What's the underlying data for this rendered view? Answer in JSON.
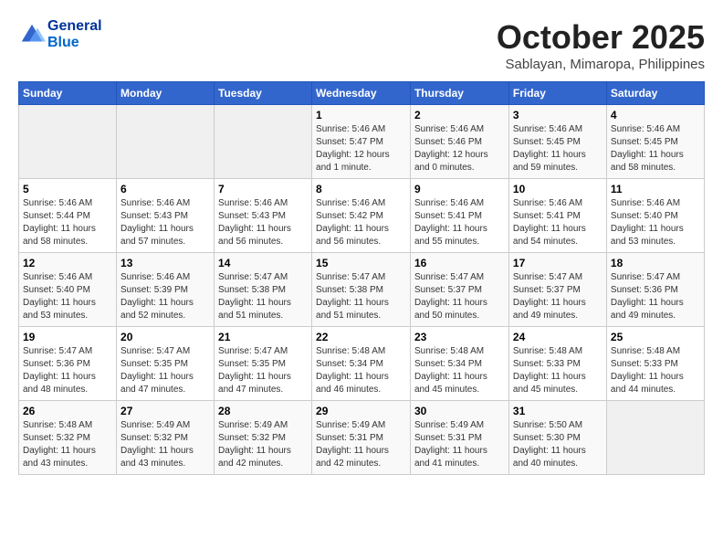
{
  "header": {
    "logo_line1": "General",
    "logo_line2": "Blue",
    "month": "October 2025",
    "location": "Sablayan, Mimaropa, Philippines"
  },
  "weekdays": [
    "Sunday",
    "Monday",
    "Tuesday",
    "Wednesday",
    "Thursday",
    "Friday",
    "Saturday"
  ],
  "weeks": [
    [
      {
        "day": "",
        "info": ""
      },
      {
        "day": "",
        "info": ""
      },
      {
        "day": "",
        "info": ""
      },
      {
        "day": "1",
        "info": "Sunrise: 5:46 AM\nSunset: 5:47 PM\nDaylight: 12 hours\nand 1 minute."
      },
      {
        "day": "2",
        "info": "Sunrise: 5:46 AM\nSunset: 5:46 PM\nDaylight: 12 hours\nand 0 minutes."
      },
      {
        "day": "3",
        "info": "Sunrise: 5:46 AM\nSunset: 5:45 PM\nDaylight: 11 hours\nand 59 minutes."
      },
      {
        "day": "4",
        "info": "Sunrise: 5:46 AM\nSunset: 5:45 PM\nDaylight: 11 hours\nand 58 minutes."
      }
    ],
    [
      {
        "day": "5",
        "info": "Sunrise: 5:46 AM\nSunset: 5:44 PM\nDaylight: 11 hours\nand 58 minutes."
      },
      {
        "day": "6",
        "info": "Sunrise: 5:46 AM\nSunset: 5:43 PM\nDaylight: 11 hours\nand 57 minutes."
      },
      {
        "day": "7",
        "info": "Sunrise: 5:46 AM\nSunset: 5:43 PM\nDaylight: 11 hours\nand 56 minutes."
      },
      {
        "day": "8",
        "info": "Sunrise: 5:46 AM\nSunset: 5:42 PM\nDaylight: 11 hours\nand 56 minutes."
      },
      {
        "day": "9",
        "info": "Sunrise: 5:46 AM\nSunset: 5:41 PM\nDaylight: 11 hours\nand 55 minutes."
      },
      {
        "day": "10",
        "info": "Sunrise: 5:46 AM\nSunset: 5:41 PM\nDaylight: 11 hours\nand 54 minutes."
      },
      {
        "day": "11",
        "info": "Sunrise: 5:46 AM\nSunset: 5:40 PM\nDaylight: 11 hours\nand 53 minutes."
      }
    ],
    [
      {
        "day": "12",
        "info": "Sunrise: 5:46 AM\nSunset: 5:40 PM\nDaylight: 11 hours\nand 53 minutes."
      },
      {
        "day": "13",
        "info": "Sunrise: 5:46 AM\nSunset: 5:39 PM\nDaylight: 11 hours\nand 52 minutes."
      },
      {
        "day": "14",
        "info": "Sunrise: 5:47 AM\nSunset: 5:38 PM\nDaylight: 11 hours\nand 51 minutes."
      },
      {
        "day": "15",
        "info": "Sunrise: 5:47 AM\nSunset: 5:38 PM\nDaylight: 11 hours\nand 51 minutes."
      },
      {
        "day": "16",
        "info": "Sunrise: 5:47 AM\nSunset: 5:37 PM\nDaylight: 11 hours\nand 50 minutes."
      },
      {
        "day": "17",
        "info": "Sunrise: 5:47 AM\nSunset: 5:37 PM\nDaylight: 11 hours\nand 49 minutes."
      },
      {
        "day": "18",
        "info": "Sunrise: 5:47 AM\nSunset: 5:36 PM\nDaylight: 11 hours\nand 49 minutes."
      }
    ],
    [
      {
        "day": "19",
        "info": "Sunrise: 5:47 AM\nSunset: 5:36 PM\nDaylight: 11 hours\nand 48 minutes."
      },
      {
        "day": "20",
        "info": "Sunrise: 5:47 AM\nSunset: 5:35 PM\nDaylight: 11 hours\nand 47 minutes."
      },
      {
        "day": "21",
        "info": "Sunrise: 5:47 AM\nSunset: 5:35 PM\nDaylight: 11 hours\nand 47 minutes."
      },
      {
        "day": "22",
        "info": "Sunrise: 5:48 AM\nSunset: 5:34 PM\nDaylight: 11 hours\nand 46 minutes."
      },
      {
        "day": "23",
        "info": "Sunrise: 5:48 AM\nSunset: 5:34 PM\nDaylight: 11 hours\nand 45 minutes."
      },
      {
        "day": "24",
        "info": "Sunrise: 5:48 AM\nSunset: 5:33 PM\nDaylight: 11 hours\nand 45 minutes."
      },
      {
        "day": "25",
        "info": "Sunrise: 5:48 AM\nSunset: 5:33 PM\nDaylight: 11 hours\nand 44 minutes."
      }
    ],
    [
      {
        "day": "26",
        "info": "Sunrise: 5:48 AM\nSunset: 5:32 PM\nDaylight: 11 hours\nand 43 minutes."
      },
      {
        "day": "27",
        "info": "Sunrise: 5:49 AM\nSunset: 5:32 PM\nDaylight: 11 hours\nand 43 minutes."
      },
      {
        "day": "28",
        "info": "Sunrise: 5:49 AM\nSunset: 5:32 PM\nDaylight: 11 hours\nand 42 minutes."
      },
      {
        "day": "29",
        "info": "Sunrise: 5:49 AM\nSunset: 5:31 PM\nDaylight: 11 hours\nand 42 minutes."
      },
      {
        "day": "30",
        "info": "Sunrise: 5:49 AM\nSunset: 5:31 PM\nDaylight: 11 hours\nand 41 minutes."
      },
      {
        "day": "31",
        "info": "Sunrise: 5:50 AM\nSunset: 5:30 PM\nDaylight: 11 hours\nand 40 minutes."
      },
      {
        "day": "",
        "info": ""
      }
    ]
  ]
}
